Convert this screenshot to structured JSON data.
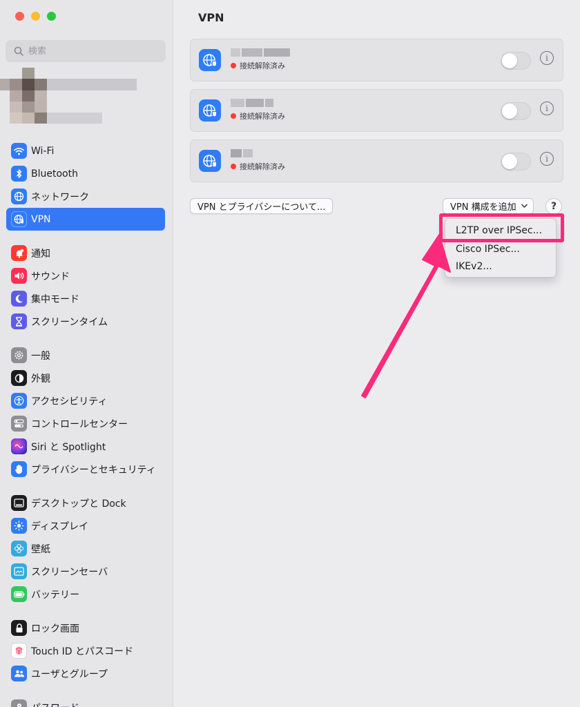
{
  "sidebar": {
    "search_placeholder": "検索",
    "items": [
      {
        "label": "Wi-Fi",
        "icon": "wifi-icon",
        "color": "#2f7cf6"
      },
      {
        "label": "Bluetooth",
        "icon": "bluetooth-icon",
        "color": "#2f7cf6"
      },
      {
        "label": "ネットワーク",
        "icon": "globe-icon",
        "color": "#2f7cf6"
      },
      {
        "label": "VPN",
        "icon": "vpn-globe-icon",
        "color": "#2f7cf6",
        "active": true
      },
      {
        "label": "通知",
        "icon": "bell-icon",
        "color": "#ff3b30"
      },
      {
        "label": "サウンド",
        "icon": "speaker-icon",
        "color": "#ff2d55"
      },
      {
        "label": "集中モード",
        "icon": "moon-icon",
        "color": "#5e5ce6"
      },
      {
        "label": "スクリーンタイム",
        "icon": "hourglass-icon",
        "color": "#5e5ce6"
      },
      {
        "label": "一般",
        "icon": "gear-icon",
        "color": "#8e8e93"
      },
      {
        "label": "外観",
        "icon": "appearance-icon",
        "color": "#1c1c1e"
      },
      {
        "label": "アクセシビリティ",
        "icon": "accessibility-icon",
        "color": "#2f7cf6"
      },
      {
        "label": "コントロールセンター",
        "icon": "toggles-icon",
        "color": "#8e8e93"
      },
      {
        "label": "Siri と Spotlight",
        "icon": "siri-icon",
        "color": "#3a3a9e"
      },
      {
        "label": "プライバシーとセキュリティ",
        "icon": "hand-icon",
        "color": "#2f7cf6"
      },
      {
        "label": "デスクトップと Dock",
        "icon": "dock-icon",
        "color": "#1c1c1e"
      },
      {
        "label": "ディスプレイ",
        "icon": "sun-icon",
        "color": "#2f7cf6"
      },
      {
        "label": "壁紙",
        "icon": "flower-icon",
        "color": "#35aadc"
      },
      {
        "label": "スクリーンセーバ",
        "icon": "screensaver-icon",
        "color": "#35aadc"
      },
      {
        "label": "バッテリー",
        "icon": "battery-icon",
        "color": "#34c759"
      },
      {
        "label": "ロック画面",
        "icon": "lock-icon",
        "color": "#1c1c1e"
      },
      {
        "label": "Touch ID とパスコード",
        "icon": "fingerprint-icon",
        "color": "#ffffff"
      },
      {
        "label": "ユーザとグループ",
        "icon": "users-icon",
        "color": "#2f7cf6"
      },
      {
        "label": "パスワード",
        "icon": "key-icon",
        "color": "#8e8e93"
      }
    ]
  },
  "main": {
    "title": "VPN",
    "vpn_rows": [
      {
        "status": "接続解除済み"
      },
      {
        "status": "接続解除済み"
      },
      {
        "status": "接続解除済み"
      }
    ],
    "about_button": "VPN とプライバシーについて...",
    "add_button": "VPN 構成を追加",
    "help_label": "?",
    "info_label": "i",
    "menu": [
      "L2TP over IPSec...",
      "Cisco IPSec...",
      "IKEv2..."
    ]
  },
  "colors": {
    "accent": "#3478f6",
    "annotation": "#fb2a7a",
    "status_red": "#ff3b30"
  }
}
